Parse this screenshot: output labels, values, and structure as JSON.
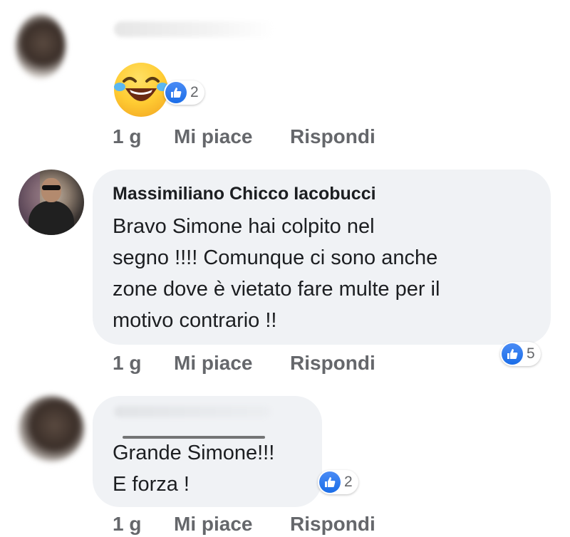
{
  "comments": [
    {
      "author": "",
      "text": "",
      "reaction_count": "2",
      "time": "1 g",
      "like_label": "Mi piace",
      "reply_label": "Rispondi"
    },
    {
      "author": "Massimiliano Chicco Iacobucci",
      "text": "Bravo Simone hai colpito nel\nsegno !!!!  Comunque ci sono anche\nzone dove è vietato fare multe per il\nmotivo contrario !!",
      "reaction_count": "5",
      "time": "1 g",
      "like_label": "Mi piace",
      "reply_label": "Rispondi"
    },
    {
      "author": "",
      "text": "Grande Simone!!!\nE forza !",
      "reaction_count": "2",
      "time": "1 g",
      "like_label": "Mi piace",
      "reply_label": "Rispondi"
    }
  ],
  "icons": {
    "emoji": "laughing-tears-emoji-icon",
    "like": "thumbs-up-icon"
  },
  "colors": {
    "bubble": "#f0f2f5",
    "like_blue": "#1b6ee8",
    "secondary_text": "#65676b"
  }
}
